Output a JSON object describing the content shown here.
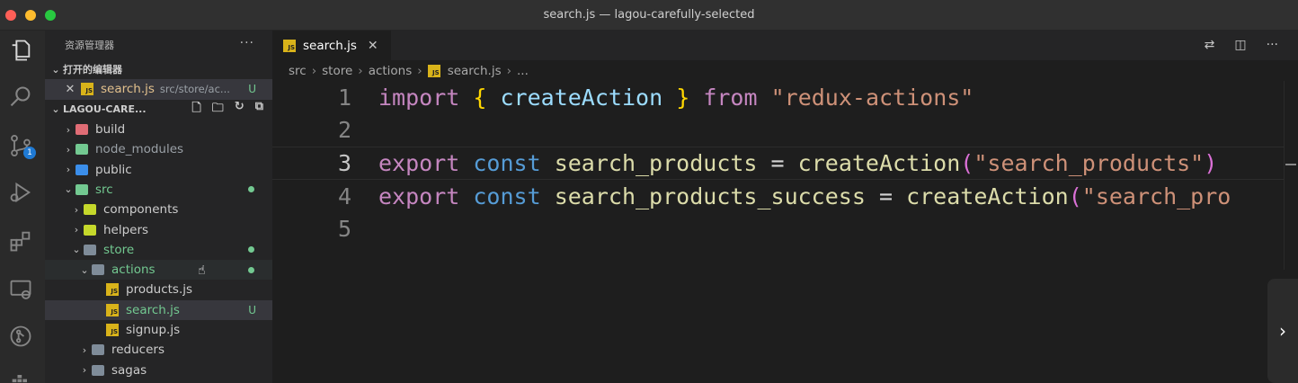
{
  "window": {
    "title": "search.js — lagou-carefully-selected"
  },
  "activity_bar": {
    "scm_badge": "1"
  },
  "sidebar": {
    "header": "资源管理器",
    "more": "···",
    "open_editors": {
      "title": "打开的编辑器",
      "items": [
        {
          "name": "search.js",
          "hint": "src/store/ac...",
          "status": "U"
        }
      ]
    },
    "project": {
      "title": "LAGOU-CARE...",
      "tree": [
        {
          "label": "build",
          "chevron": "›",
          "color": "#e06c75"
        },
        {
          "label": "node_modules",
          "chevron": "›",
          "color": "#73c991"
        },
        {
          "label": "public",
          "chevron": "›",
          "color": "#3b8eea"
        },
        {
          "label": "src",
          "chevron": "⌄",
          "color": "#73c991"
        },
        {
          "label": "components",
          "chevron": "›",
          "color": "#c5d82b"
        },
        {
          "label": "helpers",
          "chevron": "›",
          "color": "#c5d82b"
        },
        {
          "label": "store",
          "chevron": "⌄",
          "color": "#7f8c99"
        },
        {
          "label": "actions",
          "chevron": "⌄",
          "color": "#7f8c99"
        },
        {
          "label": "products.js"
        },
        {
          "label": "search.js",
          "status": "U"
        },
        {
          "label": "signup.js"
        },
        {
          "label": "reducers",
          "chevron": "›",
          "color": "#7f8c99"
        },
        {
          "label": "sagas",
          "chevron": "›",
          "color": "#7f8c99"
        }
      ]
    }
  },
  "editor": {
    "tab": {
      "label": "search.js",
      "close": "✕"
    },
    "breadcrumbs": [
      "src",
      "store",
      "actions",
      "search.js",
      "..."
    ],
    "lines": [
      {
        "num": "1",
        "tokens": [
          "import",
          "{",
          "createAction",
          "}",
          "from",
          "\"redux-actions\""
        ]
      },
      {
        "num": "2",
        "tokens": []
      },
      {
        "num": "3",
        "tokens": [
          "export",
          "const",
          "search_products",
          "=",
          "createAction",
          "(",
          "\"search_products\"",
          ")"
        ]
      },
      {
        "num": "4",
        "tokens": [
          "export",
          "const",
          "search_products_success",
          "=",
          "createAction",
          "(",
          "\"search_pro"
        ]
      },
      {
        "num": "5",
        "tokens": []
      }
    ]
  },
  "colors": {
    "keyword": "#c586c0",
    "declaration": "#569cd6",
    "identifier": "#9cdcfe",
    "function": "#dcdcaa",
    "string": "#ce9178",
    "modified": "#73c991"
  }
}
